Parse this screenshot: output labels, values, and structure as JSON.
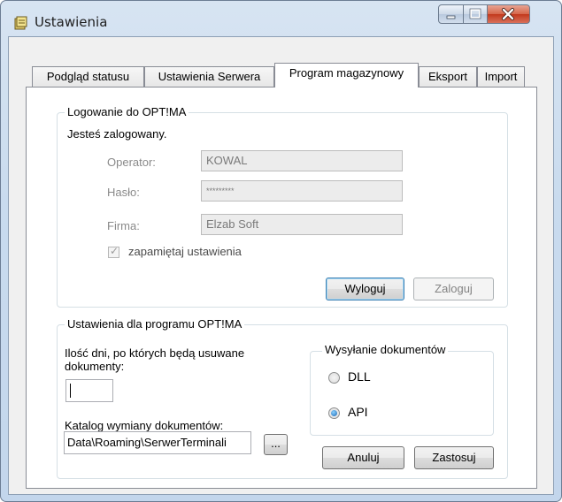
{
  "window": {
    "title": "Ustawienia"
  },
  "tabs": [
    {
      "label": "Podgląd statusu"
    },
    {
      "label": "Ustawienia Serwera"
    },
    {
      "label": "Program magazynowy"
    },
    {
      "label": "Eksport"
    },
    {
      "label": "Import"
    }
  ],
  "login_group": {
    "legend": "Logowanie do OPT!MA",
    "status": "Jesteś zalogowany.",
    "operator_label": "Operator:",
    "operator_value": "KOWAL",
    "password_label": "Hasło:",
    "password_value": "*********",
    "company_label": "Firma:",
    "company_value": "Elzab Soft",
    "remember_label": "zapamiętaj ustawienia",
    "logout_button": "Wyloguj",
    "login_button": "Zaloguj"
  },
  "settings_group": {
    "legend": "Ustawienia dla programu OPT!MA",
    "days_label_line1": "Ilość dni, po których będą usuwane",
    "days_label_line2": "dokumenty:",
    "days_value": "",
    "catalog_label": "Katalog wymiany dokumentów:",
    "catalog_value": "Data\\Roaming\\SerwerTerminali",
    "browse_button": "...",
    "sending_legend": "Wysyłanie dokumentów",
    "radio_dll": "DLL",
    "radio_api": "API",
    "cancel_button": "Anuluj",
    "apply_button": "Zastosuj"
  },
  "colors": {
    "accent": "#3c7fb1",
    "close_button": "#c2391d"
  }
}
